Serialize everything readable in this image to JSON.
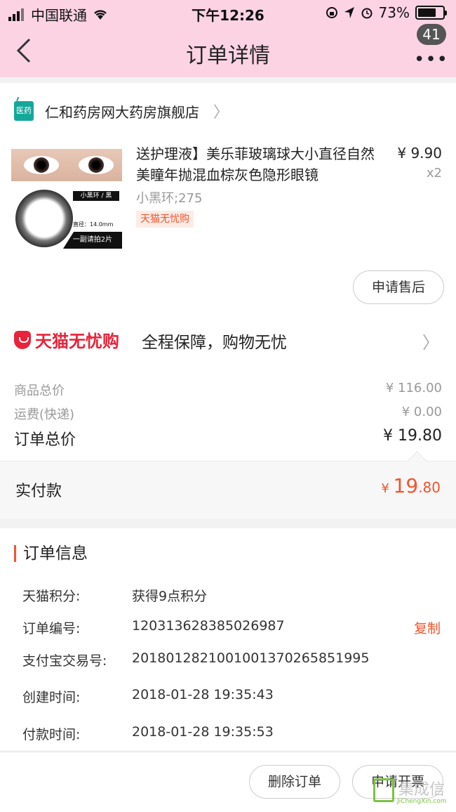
{
  "status_bar": {
    "carrier": "中国联通",
    "time": "下午12:26",
    "battery": "73%",
    "battery_level": 0.73
  },
  "nav": {
    "title": "订单详情",
    "badge_count": "41"
  },
  "shop": {
    "icon_text": "医药",
    "name": "仁和药房网大药房旗舰店"
  },
  "product": {
    "title": "送护理液】美乐菲玻璃球大小直径自然美瞳年抛混血棕灰色隐形眼镜",
    "price": "¥ 9.90",
    "quantity": "x2",
    "spec": "小黑环;275",
    "tag": "天猫无忧购",
    "image": {
      "label_top": "小黑环 / 黑",
      "label_diameter": "直径：14.0mm",
      "label_bottom": "一副请拍2片"
    }
  },
  "buttons": {
    "after_sale": "申请售后",
    "delete_order": "删除订单",
    "invoice": "申请开票"
  },
  "guarantee": {
    "logo_text": "天猫无忧购",
    "text": "全程保障，购物无忧"
  },
  "fees": {
    "goods_label": "商品总价",
    "goods_value": "¥ 116.00",
    "shipping_label": "运费(快递)",
    "shipping_value": "¥ 0.00",
    "total_label": "订单总价",
    "total_value": "¥ 19.80"
  },
  "paid": {
    "label": "实付款",
    "currency": "¥ ",
    "integer": "19",
    "decimal": ".80"
  },
  "order_info": {
    "heading": "订单信息",
    "rows": [
      {
        "key": "天猫积分:",
        "value": "获得9点积分"
      },
      {
        "key": "订单编号:",
        "value": "120313628385026987"
      },
      {
        "key": "支付宝交易号:",
        "value": "2018012821001001370265851995"
      },
      {
        "key": "创建时间:",
        "value": "2018-01-28 19:35:43"
      },
      {
        "key": "付款时间:",
        "value": "2018-01-28 19:35:53"
      }
    ],
    "copy_label": "复制"
  },
  "watermark": {
    "cn": "集成信",
    "en": "JiChengXin.com"
  },
  "colors": {
    "header_bg": "#fbd3e3",
    "accent": "#f5532d",
    "tmall_red": "#e8233a"
  }
}
